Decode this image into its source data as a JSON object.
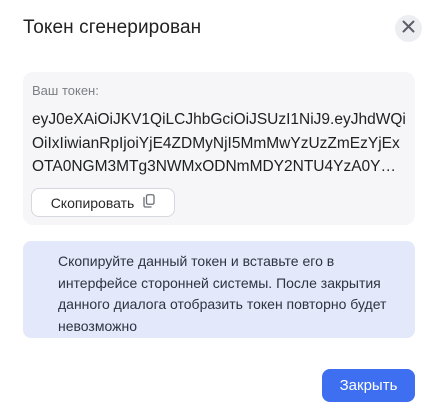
{
  "dialog": {
    "title": "Токен сгенерирован",
    "close_icon": "close-icon"
  },
  "token": {
    "label": "Ваш токен:",
    "value": "eyJ0eXAiOiJKV1QiLCJhbGciOiJSUzI1NiJ9.eyJhdWQiOiIxIiwianRpIjoiYjE4ZDMyNjI5MmMwYzUzZmEzYjExOTA0NGM3MTg3NWMxODNmMDY2NTU4YzA0Y…",
    "copy_label": "Скопировать",
    "copy_icon": "copy-icon"
  },
  "notice": {
    "text": "Скопируйте данный токен и вставьте его в интерфейсе сторонней системы. После закрытия данного диалога отобразить токен повторно будет невозможно"
  },
  "actions": {
    "close_label": "Закрыть"
  },
  "colors": {
    "primary": "#3d6ff0",
    "notice_bg": "#e3e9fb",
    "token_bg": "#f6f6f8"
  }
}
